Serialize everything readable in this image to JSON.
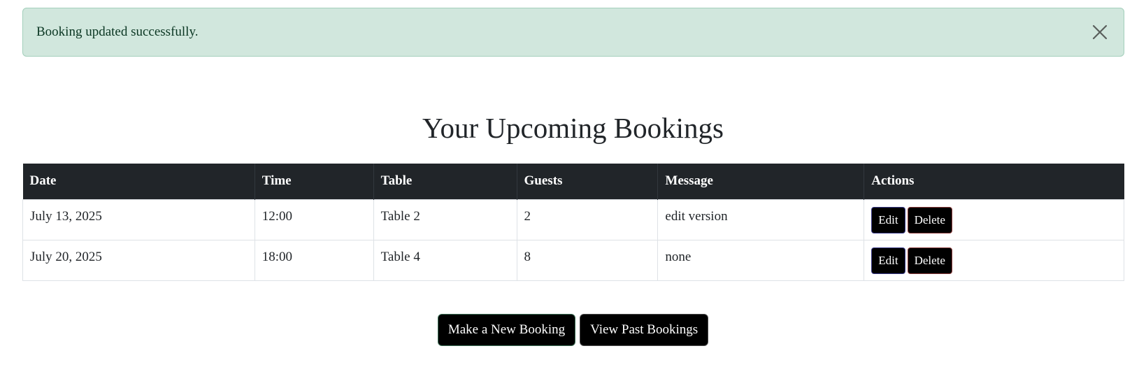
{
  "alert": {
    "message": "Booking updated successfully.",
    "close_icon": "close-icon"
  },
  "page_title": "Your Upcoming Bookings",
  "table": {
    "headers": [
      "Date",
      "Time",
      "Table",
      "Guests",
      "Message",
      "Actions"
    ],
    "rows": [
      {
        "date": "July 13, 2025",
        "time": "12:00",
        "table": "Table 2",
        "guests": "2",
        "message": "edit version",
        "edit_label": "Edit",
        "delete_label": "Delete"
      },
      {
        "date": "July 20, 2025",
        "time": "18:00",
        "table": "Table 4",
        "guests": "8",
        "message": "none",
        "edit_label": "Edit",
        "delete_label": "Delete"
      }
    ]
  },
  "actions": {
    "new_booking_label": "Make a New Booking",
    "past_bookings_label": "View Past Bookings"
  },
  "colors": {
    "alert_bg": "#d1e7dd",
    "header_bg": "#212529",
    "button_bg": "#000000"
  }
}
